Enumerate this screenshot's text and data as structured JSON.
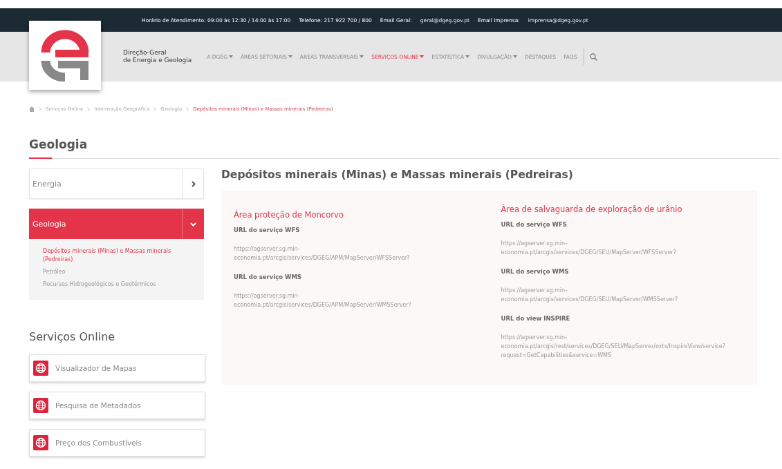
{
  "top_bar": [
    {
      "kind": "label",
      "text": "Horário de Atendimento: 09:00 às 12:30 / 14:00 às 17:00"
    },
    {
      "kind": "label",
      "text": "Telefone: 217 922 700 / 800"
    },
    {
      "kind": "label",
      "text": "Email Geral:"
    },
    {
      "kind": "link",
      "text": "geral@dgeg.gov.pt"
    },
    {
      "kind": "label",
      "text": "Email Imprensa:"
    },
    {
      "kind": "link",
      "text": "imprensa@dgeg.gov.pt"
    }
  ],
  "brand": {
    "line_1": "Direção-Geral",
    "line_2": "de Energia e Geologia"
  },
  "nav": [
    {
      "label": "A DGEG",
      "has_menu": true,
      "selected": false
    },
    {
      "label": "ÁREAS SETORIAIS",
      "has_menu": true,
      "selected": false
    },
    {
      "label": "ÁREAS TRANSVERSAIS",
      "has_menu": true,
      "selected": false
    },
    {
      "label": "SERVIÇOS ONLINE",
      "has_menu": true,
      "selected": true
    },
    {
      "label": "ESTATÍSTICA",
      "has_menu": true,
      "selected": false
    },
    {
      "label": "DIVULGAÇÃO",
      "has_menu": true,
      "selected": false
    },
    {
      "label": "DESTAQUES",
      "has_menu": false,
      "selected": false
    },
    {
      "label": "FAQS",
      "has_menu": false,
      "selected": false
    }
  ],
  "breadcrumb": [
    {
      "label": "Serviços Online",
      "current": false
    },
    {
      "label": "Informação Geográfica",
      "current": false
    },
    {
      "label": "Geologia",
      "current": false
    },
    {
      "label": "Depósitos minerais (Minas) e Massas minerais (Pedreiras)",
      "current": true
    }
  ],
  "section_title": "Geologia",
  "sidebar": {
    "items": [
      {
        "label": "Energia",
        "expanded": false,
        "selected": false
      },
      {
        "label": "Geologia",
        "expanded": true,
        "selected": true,
        "children": [
          {
            "label": "Depósitos minerais (Minas) e Massas minerais (Pedreiras)",
            "selected": true
          },
          {
            "label": "Petróleo",
            "selected": false
          },
          {
            "label": "Recursos Hidrogeológicos e Geotérmicos",
            "selected": false
          }
        ]
      }
    ],
    "services_title": "Serviços Online",
    "services": [
      {
        "label": "Visualizador de Mapas"
      },
      {
        "label": "Pesquisa de Metadados"
      },
      {
        "label": "Preço dos Combustíveis"
      }
    ]
  },
  "page_title": "Depósitos minerais (Minas) e Massas minerais (Pedreiras)",
  "columns": [
    {
      "title": "Área proteção de Moncorvo",
      "entries": [
        {
          "heading": "URL do serviço WFS",
          "url": "https://agserver.sg.min-economia.pt/arcgis/services/DGEG/APM/MapServer/WFSServer?"
        },
        {
          "heading": "URL do serviço WMS",
          "url": "https://agserver.sg.min-economia.pt/arcgis/services/DGEG/APM/MapServer/WMSServer?"
        }
      ]
    },
    {
      "title": "Área de salvaguarda de exploração de urânio",
      "entries": [
        {
          "heading": "URL do serviço WFS",
          "url": "https://agserver.sg.min-economia.pt/arcgis/services/DGEG/SEU/MapServer/WFSServer?"
        },
        {
          "heading": "URL do serviço WMS",
          "url": "https://agserver.sg.min-economia.pt/arcgis/services/DGEG/SEU/MapServer/WMSServer?"
        },
        {
          "heading": "URL do view INSPIRE",
          "url": "https://agserver.sg.min-economia.pt/arcgis/rest/services/DGEG/SEU/MapServer/exts/InspireView/service?request=GetCapabilities&service=WMS"
        }
      ]
    }
  ]
}
